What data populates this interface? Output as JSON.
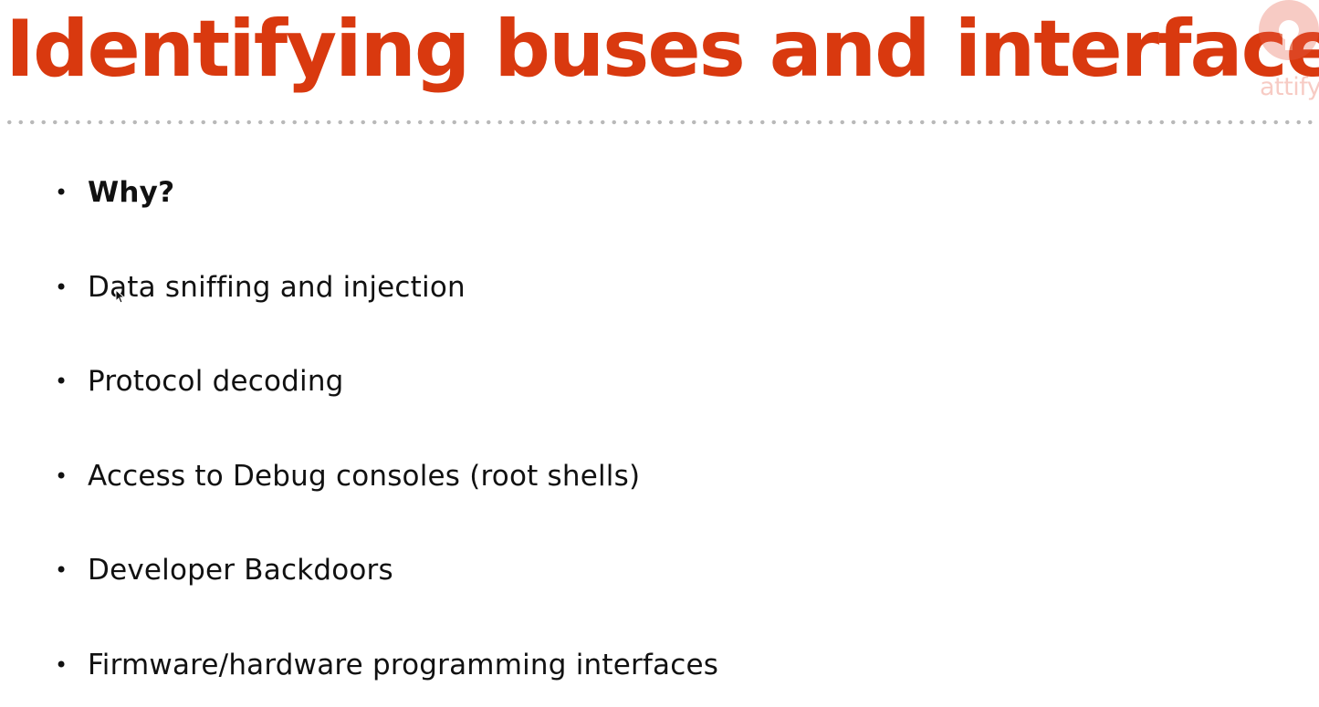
{
  "slide": {
    "title": "Identifying buses and interfaces",
    "accent_color": "#d9390f",
    "text_color": "#111111",
    "logo": {
      "text": "attify",
      "icon": "attify-logo-icon"
    },
    "bullets": [
      {
        "text": "Why?",
        "bold": true
      },
      {
        "text": "Data sniffing and injection",
        "bold": false
      },
      {
        "text": "Protocol decoding",
        "bold": false
      },
      {
        "text": "Access to Debug consoles (root shells)",
        "bold": false
      },
      {
        "text": "Developer Backdoors",
        "bold": false
      },
      {
        "text": "Firmware/hardware programming interfaces",
        "bold": false
      }
    ],
    "bullet_symbol": "•"
  }
}
